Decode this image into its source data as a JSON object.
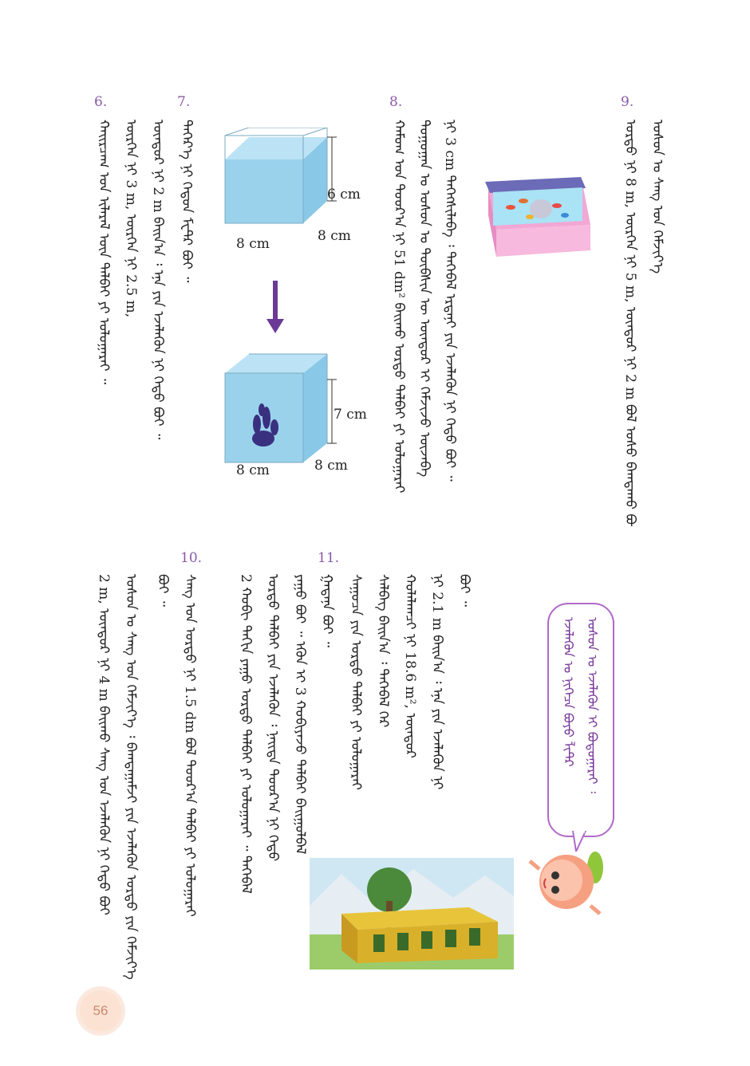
{
  "page_number": "56",
  "problems": {
    "p9": {
      "number": "9.",
      "line1": "ᠤᠰᠤᠨ ᠤ ᠰᠠᠩ ᠤᠨ ᠬᠡᠮᠵᠢᠶ᠎ᠡ",
      "line2": "ᠤᠷᠲᠤ ᠨᠢ 8 m,  ᠥᠷᠭᠡᠨ ᠨᠢ 5 m,  ᠥᠨᠳᠦᠷ ᠨᠢ 2 m ᠪᠣᠯ ᠤᠰᠤ ᠪᠠᠭᠲᠠᠬᠤ ᠪᠤᠢ"
    },
    "p8": {
      "number": "8.",
      "line1": "ᠨᠢ 3 cm ᠳᠡᠭᠡᠭᠰᠢᠯᠡᠪᠡ ᠄ ᠲᠡᠭᠡᠪᠡᠯ ᠡᠷᠳᠡᠨᠢ ᠶᠢᠨ ᠡᠵᠡᠯᠡᠬᠦᠨ ᠨᠢ ᠬᠡᠳᠦ ᠪᠤᠢ ᠃",
      "line2": "ᠲᠣᠭᠣᠭᠠᠨ ᠤ ᠤᠰᠤᠨ ᠤ ᠲᠦᠪᠰᠢᠨ ᠦ ᠥᠨᠳᠦᠷ ᠢ ᠬᠡᠮᠵᠢᠵᠦ ᠦᠵᠡᠪᠡ",
      "line3": "ᠬᠠᠮᠤᠭ ᠤᠨ ᠳᠣᠣᠷ᠎ᠠ ᠨᠢ 51 dm² ᠪᠠᠢᠬᠤ ᠤᠷᠲᠤ ᠲᠠᠯᠪᠠᠢ ᠶᠢ ᠣᠯᠣᠭᠠᠷᠠᠢ"
    },
    "p7": {
      "number": "7.",
      "line1": "ᠳᠡᠭᠡᠷ᠎ᠡ ᠨᠢ ᠬᠡᠳᠦᠨ ᠮᠧᠲᠷ ᠪᠤᠢ ᠃",
      "line2": "ᠥᠨᠳᠦᠷ ᠨᠢ 2 m ᠪᠠᠢᠨ᠎ᠠ ᠄ ᠡᠨᠡ ᠶᠢᠨ ᠡᠵᠡᠯᠡᠬᠦᠨ ᠨᠢ ᠬᠡᠳᠦ ᠪᠤᠢ ᠃",
      "line3": "ᠥᠷᠭᠡᠨ ᠨᠢ 3 m,  ᠥᠷᠭᠡᠨ ᠨᠢ 2.5 m,"
    },
    "p6": {
      "number": "6.",
      "line1": "ᠬᠠᠢᠷᠴᠠᠭ ᠤᠨ ᠢᠯᠡᠷᠡᠯ ᠦᠨ ᠲᠠᠯᠪᠠᠢ ᠶᠢ ᠣᠯᠣᠭᠠᠷᠠᠢ ᠃"
    },
    "p11": {
      "number": "11.",
      "line0": "ᠪᠤᠢ ᠃",
      "line1": "ᠨᠢ 2.1 m ᠪᠠᠢᠨ᠎ᠠ ᠄ ᠡᠨᠡ ᠶᠢᠨ ᠡᠵᠡᠯᠡᠬᠦᠨ ᠨᠢ",
      "line2": "ᠬᠤᠯᠠᠯᠠᠭᠴᠢ ᠨᠢ 18.6 m², ᠥᠨᠳᠦᠷ",
      "line3": "ᠰᠡᠯᠪᠡᠭ ᠪᠠᠢᠨ᠎ᠠ ᠄ ᠲᠡᠭᠡᠪᠡᠯ ᠭᠡᠷ",
      "line4": "ᠰᠠᠭᠤᠴᠠ ᠶᠢᠨ ᠤᠷᠲᠤ ᠲᠠᠯᠪᠠᠢ ᠶᠢ ᠣᠯᠣᠭᠠᠷᠠᠢ",
      "line5": "ᠭᠠᠳᠠᠨᠠ ᠪᠤᠢ ᠃"
    },
    "p10": {
      "number": "10.",
      "line0": "ᠶᠠᠭᠤ ᠪᠤᠢ ᠃ ᠡᠭᠦᠨ ᠢ 3 ᠬᠤᠪᠢᠶᠠᠵᠤ ᠲᠠᠯᠪᠠᠢ ᠪᠠᠢᠭᠤᠯᠪᠠᠯ",
      "line1": "ᠤᠷᠲᠤ ᠲᠠᠯᠪᠠᠢ ᠶᠢᠨ ᠡᠵᠡᠯᠡᠬᠦᠨ ᠄ ᠨᠡᠢᠲᠡ ᠳᠣᠣᠷ᠎ᠠ ᠨᠢ ᠬᠡᠳᠦ",
      "line2": "2 ᠬᠤᠪᠢ ᠳᠠᠬᠢᠨ ᠶᠠᠭᠤ ᠤᠷᠲᠤ ᠲᠠᠯᠪᠠᠢ ᠶᠢ ᠣᠯᠣᠭᠠᠷᠠᠢ ᠃ ᠲᠡᠭᠡᠪᠡᠯ",
      "line3": "ᠰᠠᠩ ᠤᠨ ᠤᠷᠲᠤ ᠨᠢ 1.5 dm ᠪᠣᠯ ᠳᠣᠣᠷ᠎ᠠ ᠲᠠᠯᠪᠠᠢ ᠶᠢ ᠣᠯᠣᠭᠠᠷᠠᠢ",
      "line4": "ᠪᠤᠢ ᠃",
      "line5": "ᠤᠰᠤᠨ ᠤ ᠰᠠᠩ ᠤᠨ ᠬᠡᠮᠵᠢᠶ᠎ᠡ ᠄ ᠪᠠᠭᠲᠠᠭᠠᠮᠵᠢ ᠶᠢᠨ ᠡᠵᠡᠯᠡᠬᠦᠨ ᠤᠷᠲᠤ ᠶᠢᠨ ᠬᠡᠮᠵᠢᠶ᠎ᠡ ᠨᠢ ᠬᠡᠳᠦ",
      "line6": "2 m,  ᠥᠨᠳᠦᠷ ᠨᠢ 4 m ᠪᠠᠢᠬᠤ ᠰᠠᠩ ᠤᠨ ᠡᠵᠡᠯᠡᠬᠦᠨ ᠨᠢ ᠬᠡᠳᠦ ᠪᠤᠢ"
    }
  },
  "bubble": {
    "line1": "ᠤᠰᠤᠨ ᠤ ᠡᠵᠡᠯᠡᠬᠦᠨ ᠢ ᠪᠤᠳᠤᠭᠠᠷᠠᠢ ᠄",
    "line2": "ᠡᠵᠡᠯᠡᠬᠦᠨ ᠤ ᠨᠢᠭᠡᠴᠡ ᠪᠤᠶᠤ ᠯᠢᠲᠷ"
  },
  "figure": {
    "cube1_width": "8 cm",
    "cube1_depth": "8 cm",
    "cube1_water_height": "6 cm",
    "cube2_width": "8 cm",
    "cube2_depth": "8 cm",
    "cube2_water_height": "7 cm"
  },
  "colors": {
    "accent": "#8a5aa8",
    "water": "#8fcdea",
    "arrow": "#6a3a96",
    "bubble_border": "#b06ac8",
    "badge": "#fce2d2"
  }
}
